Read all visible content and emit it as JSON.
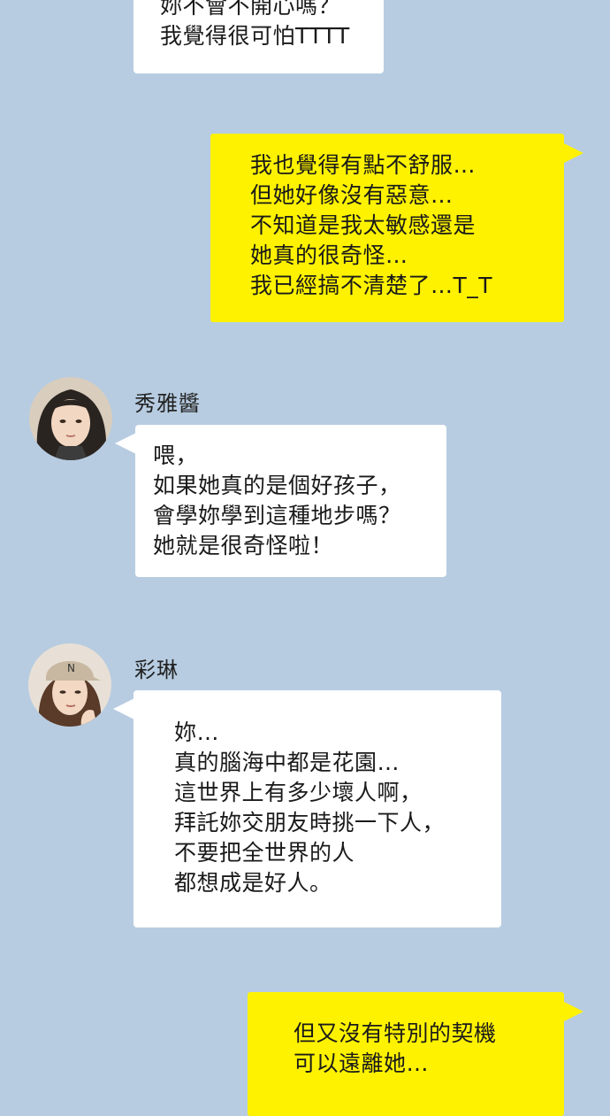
{
  "messages": [
    {
      "side": "left",
      "lines": [
        "妳不會不開心嗎？",
        "我覺得很可怕TTTT"
      ]
    },
    {
      "side": "right",
      "lines": [
        "我也覺得有點不舒服…",
        "但她好像沒有惡意…",
        "不知道是我太敏感還是",
        "她真的很奇怪…",
        "我已經搞不清楚了…T_T"
      ]
    },
    {
      "side": "left",
      "sender": "秀雅醬",
      "avatar_icon": "woman-dark-hair-avatar",
      "lines": [
        "喂，",
        "如果她真的是個好孩子，",
        "會學妳學到這種地步嗎？",
        "她就是很奇怪啦！"
      ]
    },
    {
      "side": "left",
      "sender": "彩琳",
      "avatar_icon": "woman-cap-avatar",
      "lines": [
        "妳…",
        "真的腦海中都是花園…",
        "這世界上有多少壞人啊，",
        "拜託妳交朋友時挑一下人，",
        "不要把全世界的人",
        "都想成是好人。"
      ]
    },
    {
      "side": "right",
      "lines": [
        "但又沒有特別的契機",
        "可以遠離她…"
      ]
    }
  ],
  "colors": {
    "background": "#b7cce1",
    "incoming_bubble": "#ffffff",
    "outgoing_bubble": "#fef200"
  }
}
